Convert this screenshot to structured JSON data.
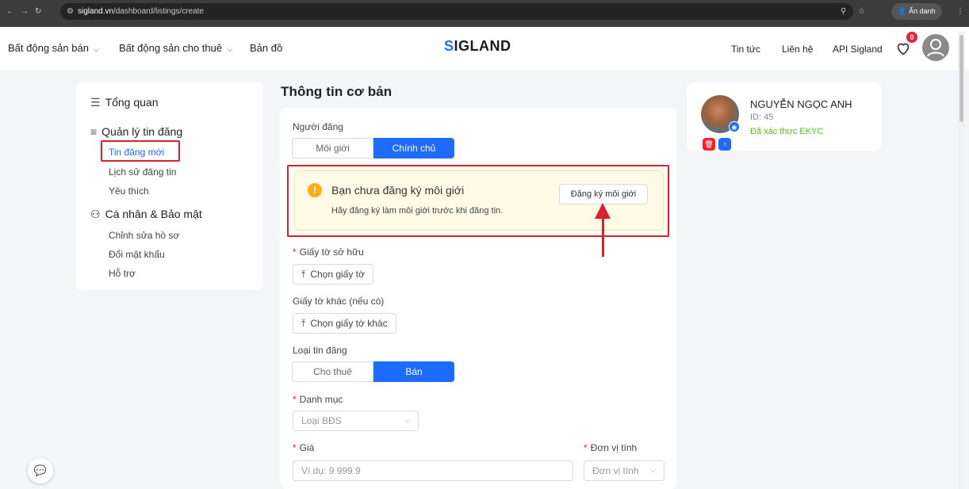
{
  "browser": {
    "url_host": "sigland.vn",
    "url_path": "/dashboard/listings/create",
    "incognito_label": "Ẩn danh"
  },
  "header": {
    "nav": [
      "Bất động sản bán",
      "Bất động sản cho thuê",
      "Bản đồ"
    ],
    "logo_text": "IGLAND",
    "right_links": [
      "Tin tức",
      "Liên hệ",
      "API Sigland"
    ],
    "favorites_badge": "0"
  },
  "sidebar": {
    "overview": "Tổng quan",
    "listings_section": "Quản lý tin đăng",
    "listings_items": [
      "Tin đăng mới",
      "Lịch sử đăng tin",
      "Yêu thích"
    ],
    "account_section": "Cá nhân & Bảo mật",
    "account_items": [
      "Chỉnh sửa hồ sơ",
      "Đổi mật khẩu",
      "Hỗ trợ"
    ]
  },
  "main": {
    "section_title": "Thông tin cơ bản",
    "poster_label": "Người đăng",
    "poster_options": [
      "Môi giới",
      "Chính chủ"
    ],
    "poster_selected": "Chính chủ",
    "warning_title": "Bạn chưa đăng ký môi giới",
    "warning_desc": "Hãy đăng ký làm môi giới trước khi đăng tin.",
    "register_button": "Đăng ký môi giới",
    "ownership_label": "Giấy tờ sở hữu",
    "choose_doc_button": "Chọn giấy tờ",
    "other_docs_label": "Giấy tờ khác (nếu có)",
    "choose_other_doc_button": "Chọn giấy tờ khác",
    "listing_type_label": "Loại tin đăng",
    "listing_type_options": [
      "Cho thuê",
      "Bán"
    ],
    "listing_type_selected": "Bán",
    "category_label": "Danh mục",
    "category_placeholder": "Loại BĐS",
    "price_label": "Giá",
    "price_placeholder": "Ví dụ: 9 999.9",
    "unit_label": "Đơn vị tính",
    "unit_placeholder": "Đơn vị tính"
  },
  "user": {
    "name": "NGUYỄN NGỌC ANH",
    "id": "ID: 45",
    "status": "Đã xác thực EKYC"
  },
  "colors": {
    "accent": "#1e6bff",
    "highlight": "#d9202d",
    "warning": "#faad14",
    "verified": "#52c41a"
  }
}
